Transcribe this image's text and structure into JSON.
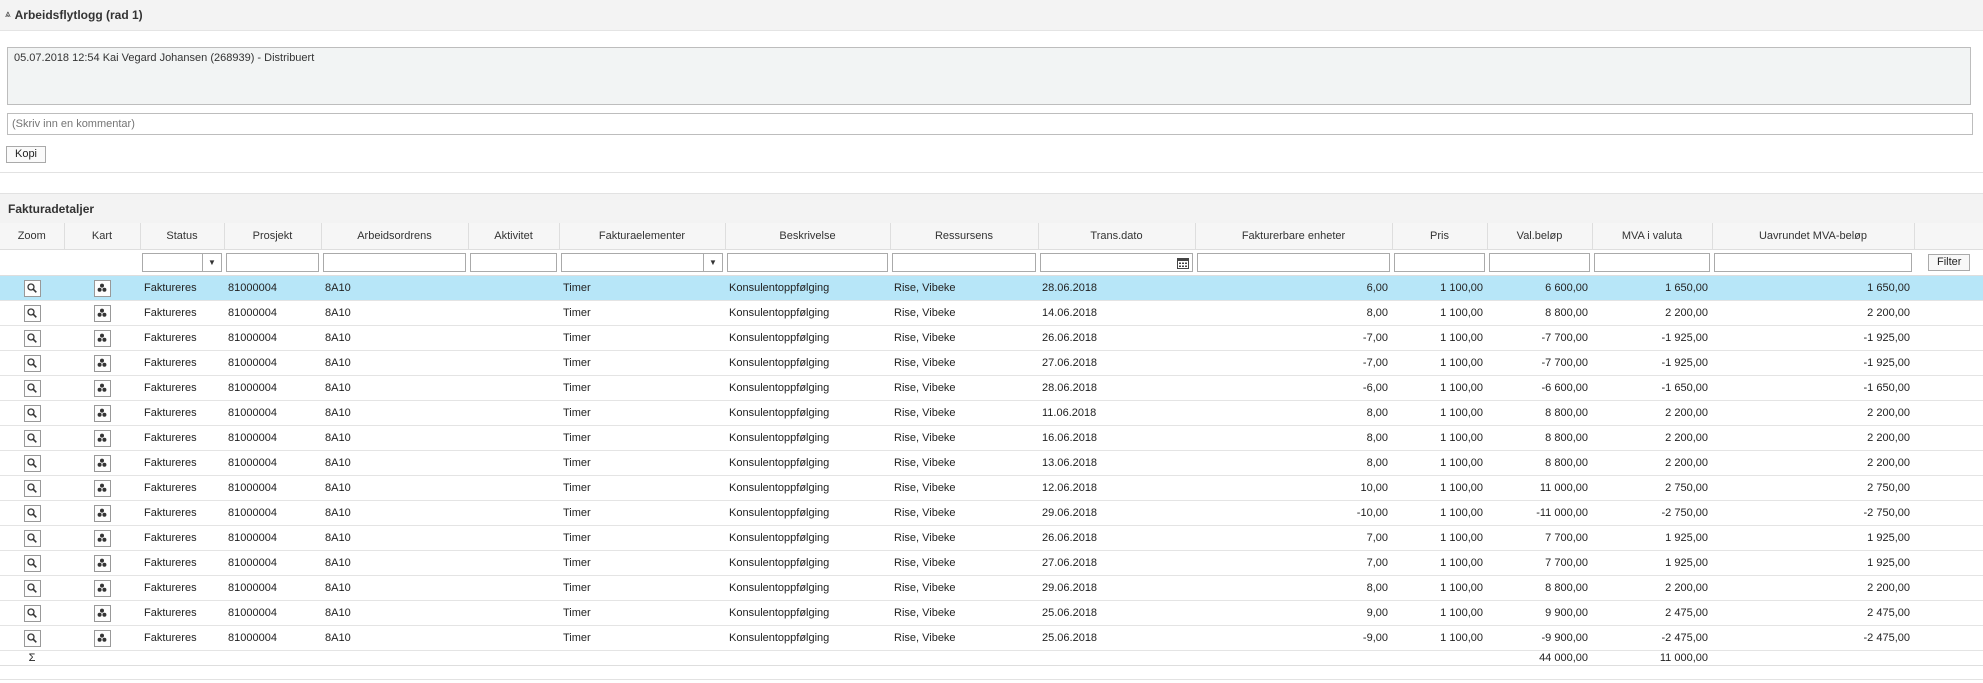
{
  "workflow": {
    "title": "Arbeidsflytlogg (rad 1)",
    "log_entry": "05.07.2018 12:54 Kai Vegard Johansen (268939) - Distribuert",
    "comment_placeholder": "(Skriv inn en kommentar)",
    "copy_label": "Kopi"
  },
  "invoice": {
    "title": "Fakturadetaljer",
    "columns": [
      "Zoom",
      "Kart",
      "Status",
      "Prosjekt",
      "Arbeidsordrens",
      "Aktivitet",
      "Fakturaelementer",
      "Beskrivelse",
      "Ressursens",
      "Trans.dato",
      "Fakturerbare enheter",
      "Pris",
      "Val.beløp",
      "MVA i valuta",
      "Uavrundet MVA-beløp"
    ],
    "filter_label": "Filter",
    "sum_symbol": "Σ",
    "totals": {
      "val_belop": "44 000,00",
      "mva": "11 000,00"
    },
    "rows": [
      {
        "status": "Faktureres",
        "prosjekt": "81000004",
        "ordre": "8A10",
        "aktivitet": "",
        "element": "Timer",
        "beskrivelse": "Konsulentoppfølging",
        "ressurs": "Rise, Vibeke",
        "dato": "28.06.2018",
        "enheter": "6,00",
        "pris": "1 100,00",
        "belop": "6 600,00",
        "mva": "1 650,00",
        "uavrundet": "1 650,00",
        "neg": false
      },
      {
        "status": "Faktureres",
        "prosjekt": "81000004",
        "ordre": "8A10",
        "aktivitet": "",
        "element": "Timer",
        "beskrivelse": "Konsulentoppfølging",
        "ressurs": "Rise, Vibeke",
        "dato": "14.06.2018",
        "enheter": "8,00",
        "pris": "1 100,00",
        "belop": "8 800,00",
        "mva": "2 200,00",
        "uavrundet": "2 200,00",
        "neg": false
      },
      {
        "status": "Faktureres",
        "prosjekt": "81000004",
        "ordre": "8A10",
        "aktivitet": "",
        "element": "Timer",
        "beskrivelse": "Konsulentoppfølging",
        "ressurs": "Rise, Vibeke",
        "dato": "26.06.2018",
        "enheter": "-7,00",
        "pris": "1 100,00",
        "belop": "-7 700,00",
        "mva": "-1 925,00",
        "uavrundet": "-1 925,00",
        "neg": true
      },
      {
        "status": "Faktureres",
        "prosjekt": "81000004",
        "ordre": "8A10",
        "aktivitet": "",
        "element": "Timer",
        "beskrivelse": "Konsulentoppfølging",
        "ressurs": "Rise, Vibeke",
        "dato": "27.06.2018",
        "enheter": "-7,00",
        "pris": "1 100,00",
        "belop": "-7 700,00",
        "mva": "-1 925,00",
        "uavrundet": "-1 925,00",
        "neg": true
      },
      {
        "status": "Faktureres",
        "prosjekt": "81000004",
        "ordre": "8A10",
        "aktivitet": "",
        "element": "Timer",
        "beskrivelse": "Konsulentoppfølging",
        "ressurs": "Rise, Vibeke",
        "dato": "28.06.2018",
        "enheter": "-6,00",
        "pris": "1 100,00",
        "belop": "-6 600,00",
        "mva": "-1 650,00",
        "uavrundet": "-1 650,00",
        "neg": true
      },
      {
        "status": "Faktureres",
        "prosjekt": "81000004",
        "ordre": "8A10",
        "aktivitet": "",
        "element": "Timer",
        "beskrivelse": "Konsulentoppfølging",
        "ressurs": "Rise, Vibeke",
        "dato": "11.06.2018",
        "enheter": "8,00",
        "pris": "1 100,00",
        "belop": "8 800,00",
        "mva": "2 200,00",
        "uavrundet": "2 200,00",
        "neg": false
      },
      {
        "status": "Faktureres",
        "prosjekt": "81000004",
        "ordre": "8A10",
        "aktivitet": "",
        "element": "Timer",
        "beskrivelse": "Konsulentoppfølging",
        "ressurs": "Rise, Vibeke",
        "dato": "16.06.2018",
        "enheter": "8,00",
        "pris": "1 100,00",
        "belop": "8 800,00",
        "mva": "2 200,00",
        "uavrundet": "2 200,00",
        "neg": false
      },
      {
        "status": "Faktureres",
        "prosjekt": "81000004",
        "ordre": "8A10",
        "aktivitet": "",
        "element": "Timer",
        "beskrivelse": "Konsulentoppfølging",
        "ressurs": "Rise, Vibeke",
        "dato": "13.06.2018",
        "enheter": "8,00",
        "pris": "1 100,00",
        "belop": "8 800,00",
        "mva": "2 200,00",
        "uavrundet": "2 200,00",
        "neg": false
      },
      {
        "status": "Faktureres",
        "prosjekt": "81000004",
        "ordre": "8A10",
        "aktivitet": "",
        "element": "Timer",
        "beskrivelse": "Konsulentoppfølging",
        "ressurs": "Rise, Vibeke",
        "dato": "12.06.2018",
        "enheter": "10,00",
        "pris": "1 100,00",
        "belop": "11 000,00",
        "mva": "2 750,00",
        "uavrundet": "2 750,00",
        "neg": false
      },
      {
        "status": "Faktureres",
        "prosjekt": "81000004",
        "ordre": "8A10",
        "aktivitet": "",
        "element": "Timer",
        "beskrivelse": "Konsulentoppfølging",
        "ressurs": "Rise, Vibeke",
        "dato": "29.06.2018",
        "enheter": "-10,00",
        "pris": "1 100,00",
        "belop": "-11 000,00",
        "mva": "-2 750,00",
        "uavrundet": "-2 750,00",
        "neg": true
      },
      {
        "status": "Faktureres",
        "prosjekt": "81000004",
        "ordre": "8A10",
        "aktivitet": "",
        "element": "Timer",
        "beskrivelse": "Konsulentoppfølging",
        "ressurs": "Rise, Vibeke",
        "dato": "26.06.2018",
        "enheter": "7,00",
        "pris": "1 100,00",
        "belop": "7 700,00",
        "mva": "1 925,00",
        "uavrundet": "1 925,00",
        "neg": false
      },
      {
        "status": "Faktureres",
        "prosjekt": "81000004",
        "ordre": "8A10",
        "aktivitet": "",
        "element": "Timer",
        "beskrivelse": "Konsulentoppfølging",
        "ressurs": "Rise, Vibeke",
        "dato": "27.06.2018",
        "enheter": "7,00",
        "pris": "1 100,00",
        "belop": "7 700,00",
        "mva": "1 925,00",
        "uavrundet": "1 925,00",
        "neg": false
      },
      {
        "status": "Faktureres",
        "prosjekt": "81000004",
        "ordre": "8A10",
        "aktivitet": "",
        "element": "Timer",
        "beskrivelse": "Konsulentoppfølging",
        "ressurs": "Rise, Vibeke",
        "dato": "29.06.2018",
        "enheter": "8,00",
        "pris": "1 100,00",
        "belop": "8 800,00",
        "mva": "2 200,00",
        "uavrundet": "2 200,00",
        "neg": false
      },
      {
        "status": "Faktureres",
        "prosjekt": "81000004",
        "ordre": "8A10",
        "aktivitet": "",
        "element": "Timer",
        "beskrivelse": "Konsulentoppfølging",
        "ressurs": "Rise, Vibeke",
        "dato": "25.06.2018",
        "enheter": "9,00",
        "pris": "1 100,00",
        "belop": "9 900,00",
        "mva": "2 475,00",
        "uavrundet": "2 475,00",
        "neg": false
      },
      {
        "status": "Faktureres",
        "prosjekt": "81000004",
        "ordre": "8A10",
        "aktivitet": "",
        "element": "Timer",
        "beskrivelse": "Konsulentoppfølging",
        "ressurs": "Rise, Vibeke",
        "dato": "25.06.2018",
        "enheter": "-9,00",
        "pris": "1 100,00",
        "belop": "-9 900,00",
        "mva": "-2 475,00",
        "uavrundet": "-2 475,00",
        "neg": true
      }
    ],
    "selected_row": 0
  },
  "colors": {
    "selected_row": "#b7e6f8",
    "negative": "#c00000"
  }
}
